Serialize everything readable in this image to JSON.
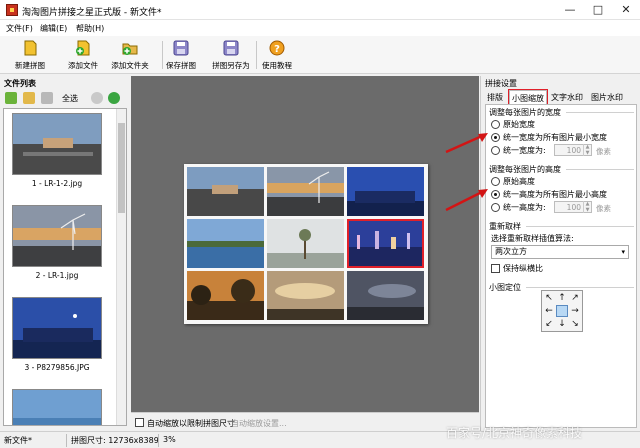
{
  "window": {
    "title": "淘淘图片拼接之星正式版 - 新文件*",
    "controls": [
      "—",
      "□",
      "✕"
    ]
  },
  "menubar": [
    {
      "label": "文件(F)"
    },
    {
      "label": "编辑(E)"
    },
    {
      "label": "帮助(H)"
    }
  ],
  "toolbar": [
    {
      "label": "新建拼图",
      "icon": "new-collage-icon"
    },
    {
      "label": "添加文件",
      "icon": "add-file-icon"
    },
    {
      "label": "添加文件夹",
      "icon": "add-folder-icon"
    },
    {
      "label": "保存拼图",
      "icon": "save-collage-icon"
    },
    {
      "label": "拼图另存为",
      "icon": "save-as-icon"
    },
    {
      "label": "使用教程",
      "icon": "help-icon"
    }
  ],
  "file_list": {
    "title": "文件列表",
    "select_all_label": "全选",
    "files": [
      {
        "name": "1 - LR-1-2.jpg"
      },
      {
        "name": "2 - LR-1.jpg"
      },
      {
        "name": "3 - P8279856.JPG"
      },
      {
        "name": ""
      }
    ]
  },
  "canvas": {
    "auto_scale_label": "自动缩放以限制拼图尺寸",
    "auto_scale_settings_label": "自动缩放设置..."
  },
  "right_panel": {
    "title": "拼接设置",
    "tabs": [
      "排版",
      "小图缩放",
      "文字水印",
      "图片水印"
    ],
    "active_tab": "小图缩放",
    "width_group": {
      "title": "调整每张图片的宽度",
      "options": [
        "原始宽度",
        "统一宽度为所有图片最小宽度",
        "统一宽度为:"
      ],
      "selected": 1,
      "value": "100",
      "unit": "像素"
    },
    "height_group": {
      "title": "调整每张图片的高度",
      "options": [
        "原始高度",
        "统一高度为所有图片最小高度",
        "统一高度为:"
      ],
      "selected": 1,
      "value": "100",
      "unit": "像素"
    },
    "resample": {
      "title": "重新取样",
      "algo_label": "选择重新取样插值算法:",
      "algo_value": "两次立方",
      "keep_ratio_label": "保持纵横比"
    },
    "position": {
      "title": "小图定位"
    }
  },
  "statusbar": {
    "file": "新文件*",
    "size": "拼图尺寸: 12736x8389",
    "zoom": "3%"
  },
  "watermark": "百家号/北京神奇像素科技",
  "colors": {
    "highlight": "#e0202a",
    "canvas_bg": "#6b6b6b"
  }
}
